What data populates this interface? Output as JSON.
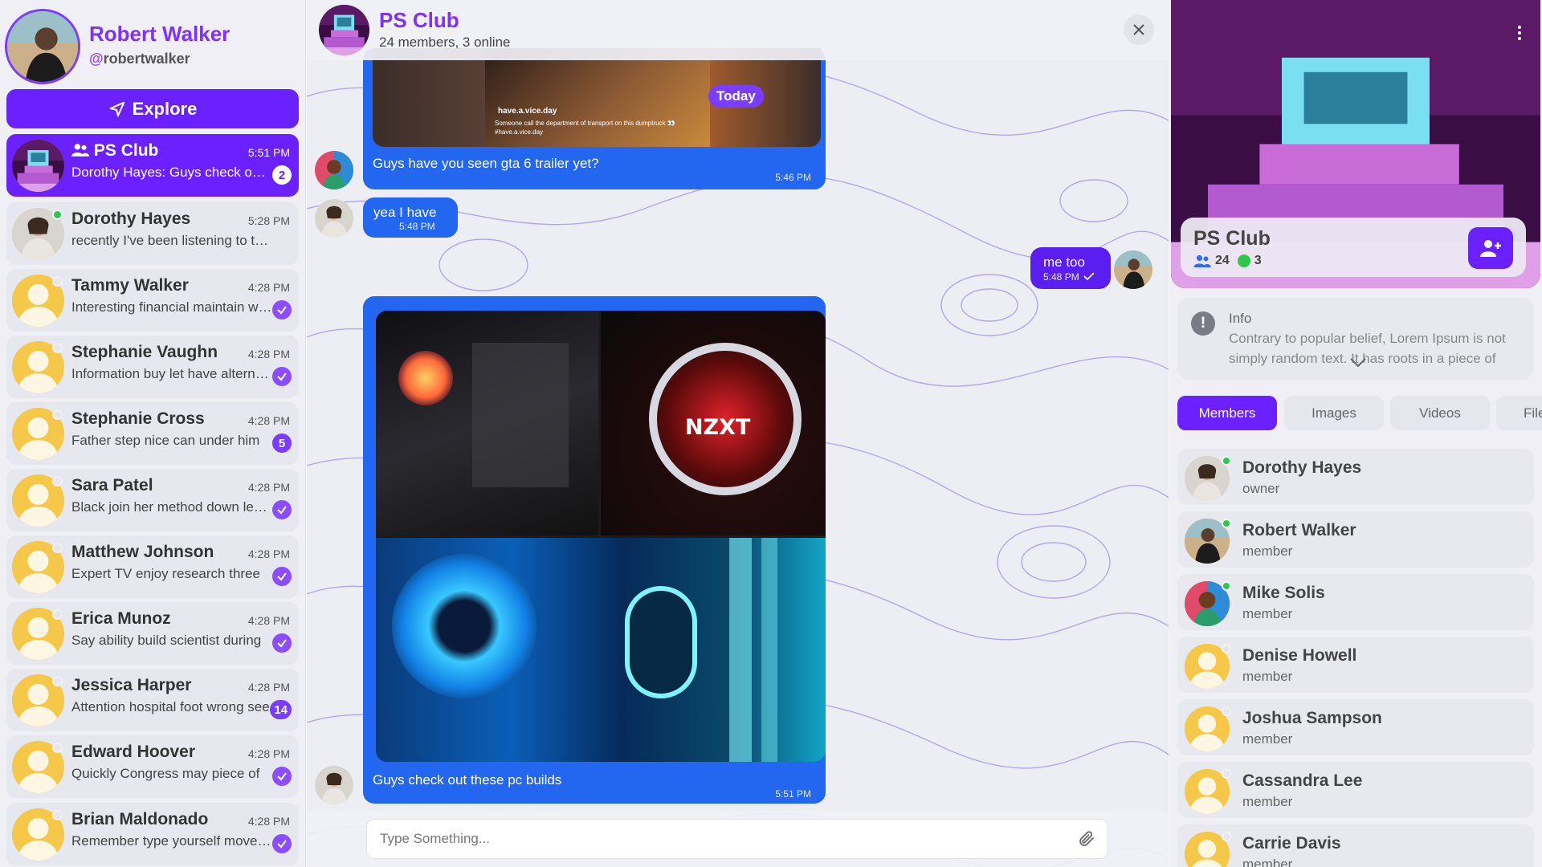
{
  "profile": {
    "name": "Robert Walker",
    "handle_at": "@",
    "handle": "robertwalker"
  },
  "explore": {
    "label": "Explore"
  },
  "conversations": [
    {
      "name": "PS Club",
      "time": "5:51 PM",
      "preview": "Dorothy Hayes: Guys check out these pc builds",
      "badge": "2",
      "active": true,
      "group": true
    },
    {
      "name": "Dorothy Hayes",
      "time": "5:28 PM",
      "preview": "recently I've been listening to the new album",
      "online": true
    },
    {
      "name": "Tammy Walker",
      "time": "4:28 PM",
      "preview": "Interesting financial maintain whatever",
      "read": true
    },
    {
      "name": "Stephanie Vaughn",
      "time": "4:28 PM",
      "preview": "Information buy let have alternative",
      "read": true
    },
    {
      "name": "Stephanie Cross",
      "time": "4:28 PM",
      "preview": "Father step nice can under him",
      "badge": "5"
    },
    {
      "name": "Sara Patel",
      "time": "4:28 PM",
      "preview": "Black join her method down learn",
      "read": true
    },
    {
      "name": "Matthew Johnson",
      "time": "4:28 PM",
      "preview": "Expert TV enjoy research three",
      "read": true
    },
    {
      "name": "Erica Munoz",
      "time": "4:28 PM",
      "preview": "Say ability build scientist during",
      "read": true
    },
    {
      "name": "Jessica Harper",
      "time": "4:28 PM",
      "preview": "Attention hospital foot wrong see",
      "badge": "14"
    },
    {
      "name": "Edward Hoover",
      "time": "4:28 PM",
      "preview": "Quickly Congress may piece of",
      "read": true
    },
    {
      "name": "Brian Maldonado",
      "time": "4:28 PM",
      "preview": "Remember type yourself move up",
      "read": true
    }
  ],
  "chat": {
    "title": "PS Club",
    "subtitle": "24 members, 3 online",
    "messages": [
      {
        "text": "Guys have you seen gta 6 trailer yet?",
        "time": "5:46 PM",
        "embed_date": "Today",
        "embed_handle": "have.a.vice.day",
        "embed_caption": "Someone call the department of transport on this dumptruck 👀 #have.a.vice.day"
      },
      {
        "text": "yea I have",
        "time": "5:48 PM"
      },
      {
        "text": "me too",
        "time": "5:48 PM"
      },
      {
        "text": "Guys check out these pc builds",
        "time": "5:51 PM",
        "image_text": "NZXT"
      }
    ],
    "composer_placeholder": "Type Something..."
  },
  "group": {
    "name": "PS Club",
    "members_count": "24",
    "online_count": "3",
    "info_label": "Info",
    "info_text": "Contrary to popular belief, Lorem Ipsum is not simply random text. It has roots in a piece of classical Latin literature"
  },
  "tabs": [
    "Members",
    "Images",
    "Videos",
    "Files"
  ],
  "members": [
    {
      "name": "Dorothy Hayes",
      "role": "owner",
      "online": true
    },
    {
      "name": "Robert Walker",
      "role": "member",
      "online": true
    },
    {
      "name": "Mike Solis",
      "role": "member",
      "online": true
    },
    {
      "name": "Denise Howell",
      "role": "member"
    },
    {
      "name": "Joshua Sampson",
      "role": "member"
    },
    {
      "name": "Cassandra Lee",
      "role": "member"
    },
    {
      "name": "Carrie Davis",
      "role": "member"
    }
  ],
  "colors": {
    "accent": "#6b21ff",
    "bubble": "#2366f0",
    "online": "#2ec74b",
    "title": "#7e30ff"
  }
}
